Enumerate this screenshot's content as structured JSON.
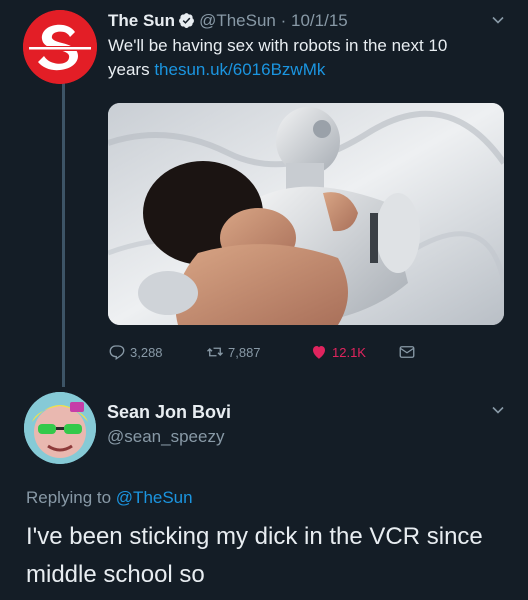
{
  "tweet": {
    "author_name": "The Sun",
    "author_handle": "@TheSun",
    "separator": "·",
    "date": "10/1/15",
    "text": "We'll be having sex with robots in the next 10 years",
    "link": "thesun.uk/6016BzwMk",
    "media_description": "photo",
    "stats": {
      "replies": "3,288",
      "retweets": "7,887",
      "likes": "12.1K"
    },
    "liked": true
  },
  "reply": {
    "author_name": "Sean Jon Bovi",
    "author_handle": "@sean_speezy",
    "replying_prefix": "Replying to",
    "replying_to": "@TheSun",
    "text": "I've been sticking my dick in the VCR since middle school so"
  },
  "colors": {
    "background": "#141d26",
    "link": "#1b95e0",
    "like": "#e0245e",
    "muted": "#8899a6",
    "sun_red": "#e31e26"
  },
  "icons": [
    "sun-logo-icon",
    "verified-badge-icon",
    "chevron-down-icon",
    "reply-icon",
    "retweet-icon",
    "heart-icon",
    "message-icon"
  ]
}
